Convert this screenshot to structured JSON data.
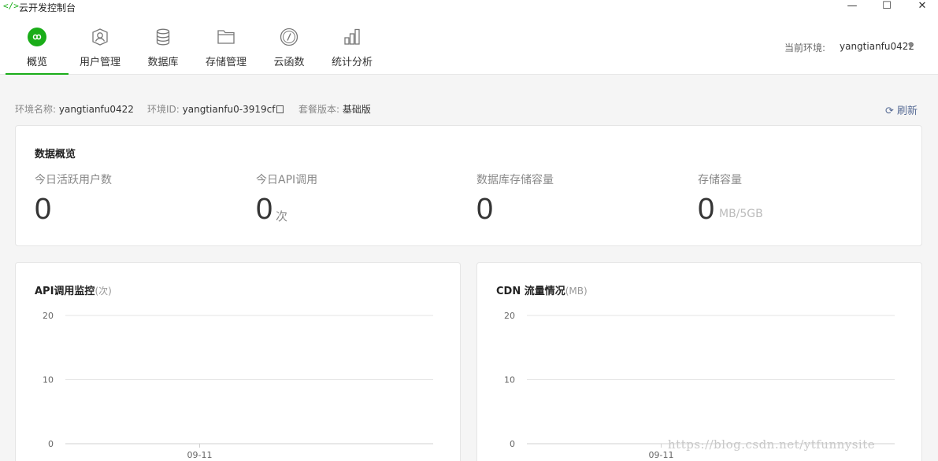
{
  "window": {
    "logo": "</>",
    "title": "云开发控制台",
    "controls": {
      "minimize": "—",
      "maximize": "☐",
      "close": "✕"
    }
  },
  "nav": {
    "tabs": [
      {
        "label": "概览",
        "icon": "overview-infinity-icon",
        "active": true
      },
      {
        "label": "用户管理",
        "icon": "user-icon"
      },
      {
        "label": "数据库",
        "icon": "database-icon"
      },
      {
        "label": "存储管理",
        "icon": "folder-icon"
      },
      {
        "label": "云函数",
        "icon": "function-icon"
      },
      {
        "label": "统计分析",
        "icon": "bar-chart-icon"
      }
    ],
    "env_label": "当前环境:",
    "env_value": "yangtianfu0422",
    "env_caret": "▼"
  },
  "info": {
    "env_name_label": "环境名称:",
    "env_name": "yangtianfu0422",
    "env_id_label": "环境ID:",
    "env_id": "yangtianfu0-3919cf",
    "plan_label": "套餐版本:",
    "plan": "基础版",
    "refresh_label": "刷新",
    "refresh_icon": "⟳"
  },
  "overview": {
    "title": "数据概览",
    "metrics": [
      {
        "label": "今日活跃用户数",
        "value": "0",
        "unit": ""
      },
      {
        "label": "今日API调用",
        "value": "0",
        "unit": "次"
      },
      {
        "label": "数据库存储容量",
        "value": "0",
        "unit": ""
      },
      {
        "label": "存储容量",
        "value": "0",
        "unit": "MB/5GB"
      }
    ]
  },
  "charts": {
    "api": {
      "title": "API调用监控",
      "unit": "(次)"
    },
    "cdn": {
      "title": "CDN 流量情况",
      "unit": "(MB)"
    }
  },
  "chart_data": [
    {
      "type": "line",
      "title": "API调用监控(次)",
      "x": [
        "09-11"
      ],
      "series": [
        {
          "values": [
            0
          ]
        }
      ],
      "yticks": [
        0,
        10,
        20
      ],
      "ylim": [
        0,
        20
      ],
      "grid": true
    },
    {
      "type": "line",
      "title": "CDN 流量情况(MB)",
      "x": [
        "09-11"
      ],
      "series": [
        {
          "values": [
            0
          ]
        }
      ],
      "yticks": [
        0,
        10,
        20
      ],
      "ylim": [
        0,
        20
      ],
      "grid": true
    }
  ],
  "watermark": "https://blog.csdn.net/ytfunnysite"
}
